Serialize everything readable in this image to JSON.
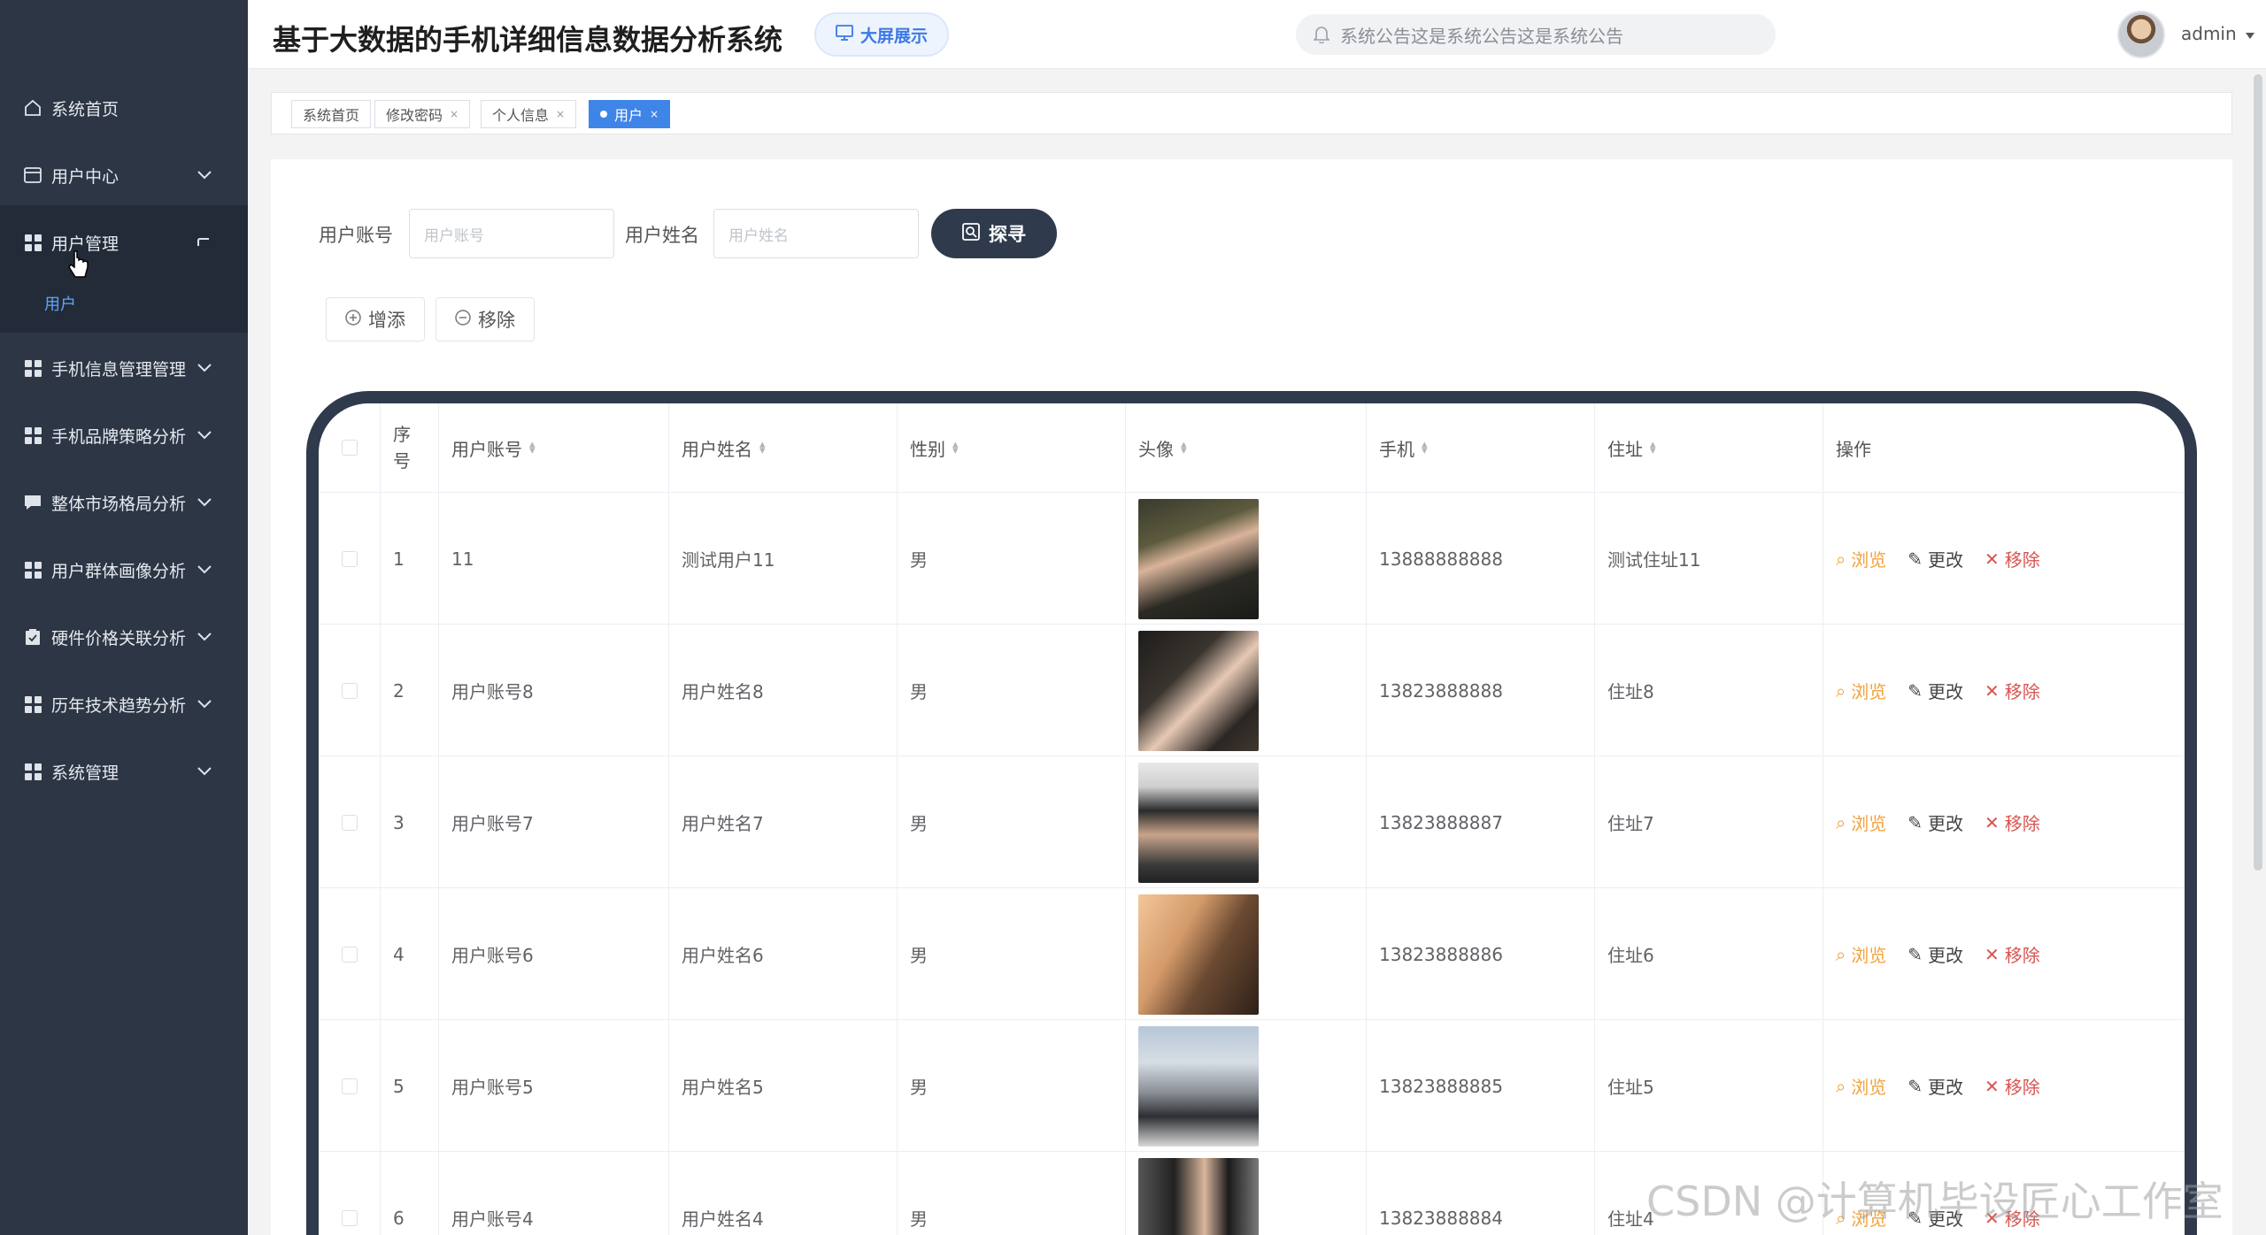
{
  "header": {
    "title": "基于大数据的手机详细信息数据分析系统",
    "screen_btn": "大屏展示",
    "notice": "系统公告这是系统公告这是系统公告",
    "user": "admin"
  },
  "sidebar": {
    "items": [
      {
        "label": "系统首页"
      },
      {
        "label": "用户中心"
      },
      {
        "label": "用户管理"
      },
      {
        "label": "手机信息管理管理"
      },
      {
        "label": "手机品牌策略分析"
      },
      {
        "label": "整体市场格局分析"
      },
      {
        "label": "用户群体画像分析"
      },
      {
        "label": "硬件价格关联分析"
      },
      {
        "label": "历年技术趋势分析"
      },
      {
        "label": "系统管理"
      }
    ],
    "sub_item": "用户"
  },
  "tabs": [
    {
      "label": "系统首页"
    },
    {
      "label": "修改密码"
    },
    {
      "label": "个人信息"
    },
    {
      "label": "用户"
    }
  ],
  "search": {
    "account_label": "用户账号",
    "account_placeholder": "用户账号",
    "name_label": "用户姓名",
    "name_placeholder": "用户姓名",
    "search_btn": "探寻"
  },
  "actions": {
    "add": "增添",
    "remove": "移除"
  },
  "table": {
    "headers": [
      "序号",
      "用户账号",
      "用户姓名",
      "性别",
      "头像",
      "手机",
      "住址",
      "操作"
    ],
    "ops": {
      "view": "浏览",
      "edit": "更改",
      "delete": "移除"
    },
    "rows": [
      {
        "no": "1",
        "account": "11",
        "name": "测试用户11",
        "gender": "男",
        "phone": "13888888888",
        "address": "测试住址11"
      },
      {
        "no": "2",
        "account": "用户账号8",
        "name": "用户姓名8",
        "gender": "男",
        "phone": "13823888888",
        "address": "住址8"
      },
      {
        "no": "3",
        "account": "用户账号7",
        "name": "用户姓名7",
        "gender": "男",
        "phone": "13823888887",
        "address": "住址7"
      },
      {
        "no": "4",
        "account": "用户账号6",
        "name": "用户姓名6",
        "gender": "男",
        "phone": "13823888886",
        "address": "住址6"
      },
      {
        "no": "5",
        "account": "用户账号5",
        "name": "用户姓名5",
        "gender": "男",
        "phone": "13823888885",
        "address": "住址5"
      },
      {
        "no": "6",
        "account": "用户账号4",
        "name": "用户姓名4",
        "gender": "男",
        "phone": "13823888884",
        "address": "住址4"
      }
    ]
  },
  "watermark": "CSDN @计算机毕设匠心工作室"
}
